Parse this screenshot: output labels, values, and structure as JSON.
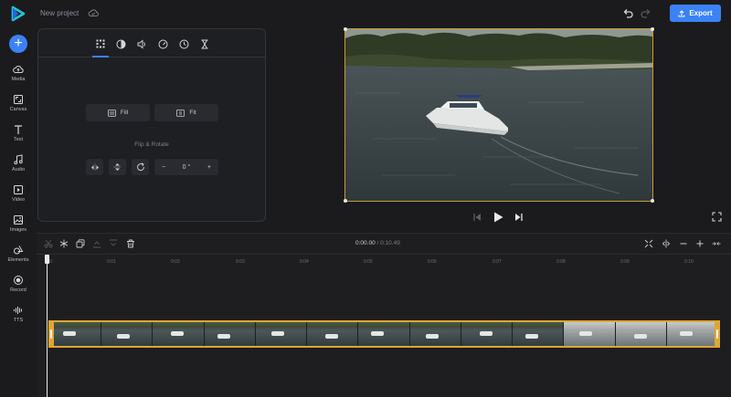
{
  "header": {
    "project_title": "New project",
    "export_label": "Export"
  },
  "sidebar": {
    "items": [
      {
        "label": "Media",
        "icon": "cloud-upload-icon"
      },
      {
        "label": "Canvas",
        "icon": "canvas-icon"
      },
      {
        "label": "Text",
        "icon": "text-icon"
      },
      {
        "label": "Audio",
        "icon": "music-note-icon"
      },
      {
        "label": "Video",
        "icon": "video-icon"
      },
      {
        "label": "Images",
        "icon": "image-icon"
      },
      {
        "label": "Elements",
        "icon": "shapes-icon"
      },
      {
        "label": "Record",
        "icon": "record-icon"
      },
      {
        "label": "TTS",
        "icon": "waveform-icon"
      }
    ]
  },
  "panel": {
    "tabs": [
      "crop-grid-icon",
      "contrast-icon",
      "volume-icon",
      "speed-icon",
      "clock-icon",
      "hourglass-icon"
    ],
    "fill_label": "Fill",
    "fit_label": "Fit",
    "flip_rotate_label": "Flip & Rotate",
    "rotation_value": "0 °"
  },
  "timeline": {
    "current_time": "0:00.00",
    "separator": "/",
    "total_time": "0:10.49",
    "ruler_ticks": [
      "0",
      "0:01",
      "0:02",
      "0:03",
      "0:04",
      "0:05",
      "0:06",
      "0:07",
      "0:08",
      "0:09",
      "0:10"
    ],
    "thumbnail_count": 13
  },
  "colors": {
    "accent": "#3b82f6",
    "clip_border": "#e0a632",
    "background": "#1b1b1e"
  }
}
